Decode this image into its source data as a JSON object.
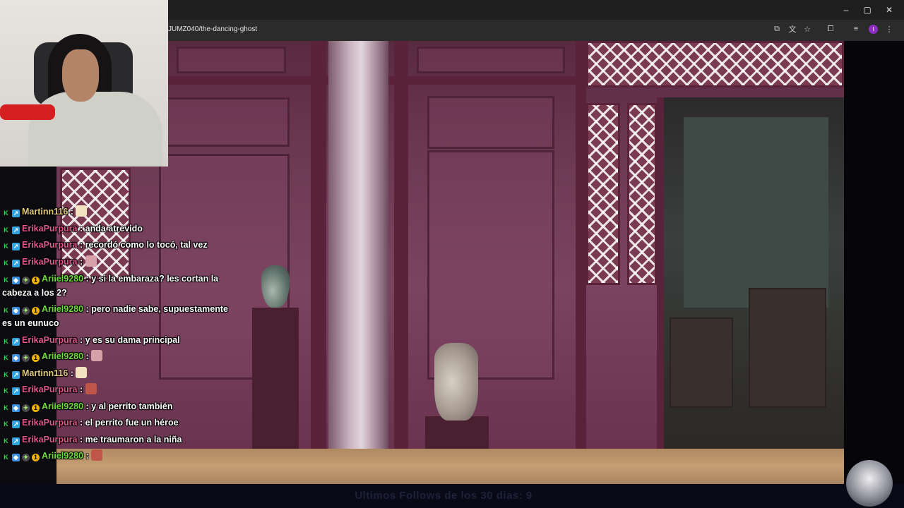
{
  "browser": {
    "url": "JUMZ040/the-dancing-ghost",
    "window_controls": {
      "minimize": "–",
      "maximize": "▢",
      "close": "✕"
    },
    "toolbar_icons": [
      "install-icon",
      "translate-icon",
      "bookmark-star-icon",
      "extensions-icon",
      "media-icon",
      "profile-icon",
      "menu-icon"
    ],
    "profile_initial": "I"
  },
  "chat": {
    "messages": [
      {
        "user": "Martinn116",
        "text": "",
        "user_class": "user-martin",
        "badges": [
          "k",
          "x"
        ],
        "emote": true
      },
      {
        "user": "ErikaPurpura",
        "text": "anda atrevido",
        "user_class": "user-erika",
        "badges": [
          "k",
          "x"
        ],
        "emote": false
      },
      {
        "user": "ErikaPurpura",
        "text": "recordó como lo tocó, tal vez",
        "user_class": "user-erika",
        "badges": [
          "k",
          "x"
        ],
        "emote": false
      },
      {
        "user": "ErikaPurpura",
        "text": "",
        "user_class": "user-erika",
        "badges": [
          "k",
          "x"
        ],
        "emote": true
      },
      {
        "user": "Ariiel9280",
        "text": "y si la embaraza? les cortan la cabeza a los 2?",
        "user_class": "user-ariel",
        "badges": [
          "k",
          "c",
          "g",
          "1"
        ],
        "emote": false
      },
      {
        "user": "Ariiel9280",
        "text": "pero nadie sabe, supuestamente es un eunuco",
        "user_class": "user-ariel",
        "badges": [
          "k",
          "c",
          "g",
          "1"
        ],
        "emote": false
      },
      {
        "user": "ErikaPurpura",
        "text": "y es su dama principal",
        "user_class": "user-erika",
        "badges": [
          "k",
          "x"
        ],
        "emote": false
      },
      {
        "user": "Ariiel9280",
        "text": "",
        "user_class": "user-ariel",
        "badges": [
          "k",
          "c",
          "g",
          "1"
        ],
        "emote": true
      },
      {
        "user": "Martinn116",
        "text": "",
        "user_class": "user-martin",
        "badges": [
          "k",
          "x"
        ],
        "emote": true
      },
      {
        "user": "ErikaPurpura",
        "text": "",
        "user_class": "user-erika",
        "badges": [
          "k",
          "x"
        ],
        "emote": true
      },
      {
        "user": "Ariiel9280",
        "text": "y al perrito también",
        "user_class": "user-ariel",
        "badges": [
          "k",
          "c",
          "g",
          "1"
        ],
        "emote": false
      },
      {
        "user": "ErikaPurpura",
        "text": "el perrito fue un héroe",
        "user_class": "user-erika",
        "badges": [
          "k",
          "x"
        ],
        "emote": false
      },
      {
        "user": "ErikaPurpura",
        "text": "me traumaron a la niña",
        "user_class": "user-erika",
        "badges": [
          "k",
          "x"
        ],
        "emote": false
      },
      {
        "user": "Ariiel9280",
        "text": "",
        "user_class": "user-ariel",
        "badges": [
          "k",
          "c",
          "g",
          "1"
        ],
        "emote": true
      }
    ],
    "separator": " : "
  },
  "overlay": {
    "follows_text": "Ultimos Follows de los 30 dias: 9"
  },
  "colors": {
    "martin": "#e2c97d",
    "erika": "#e05a8c",
    "ariel": "#6edc3a"
  }
}
